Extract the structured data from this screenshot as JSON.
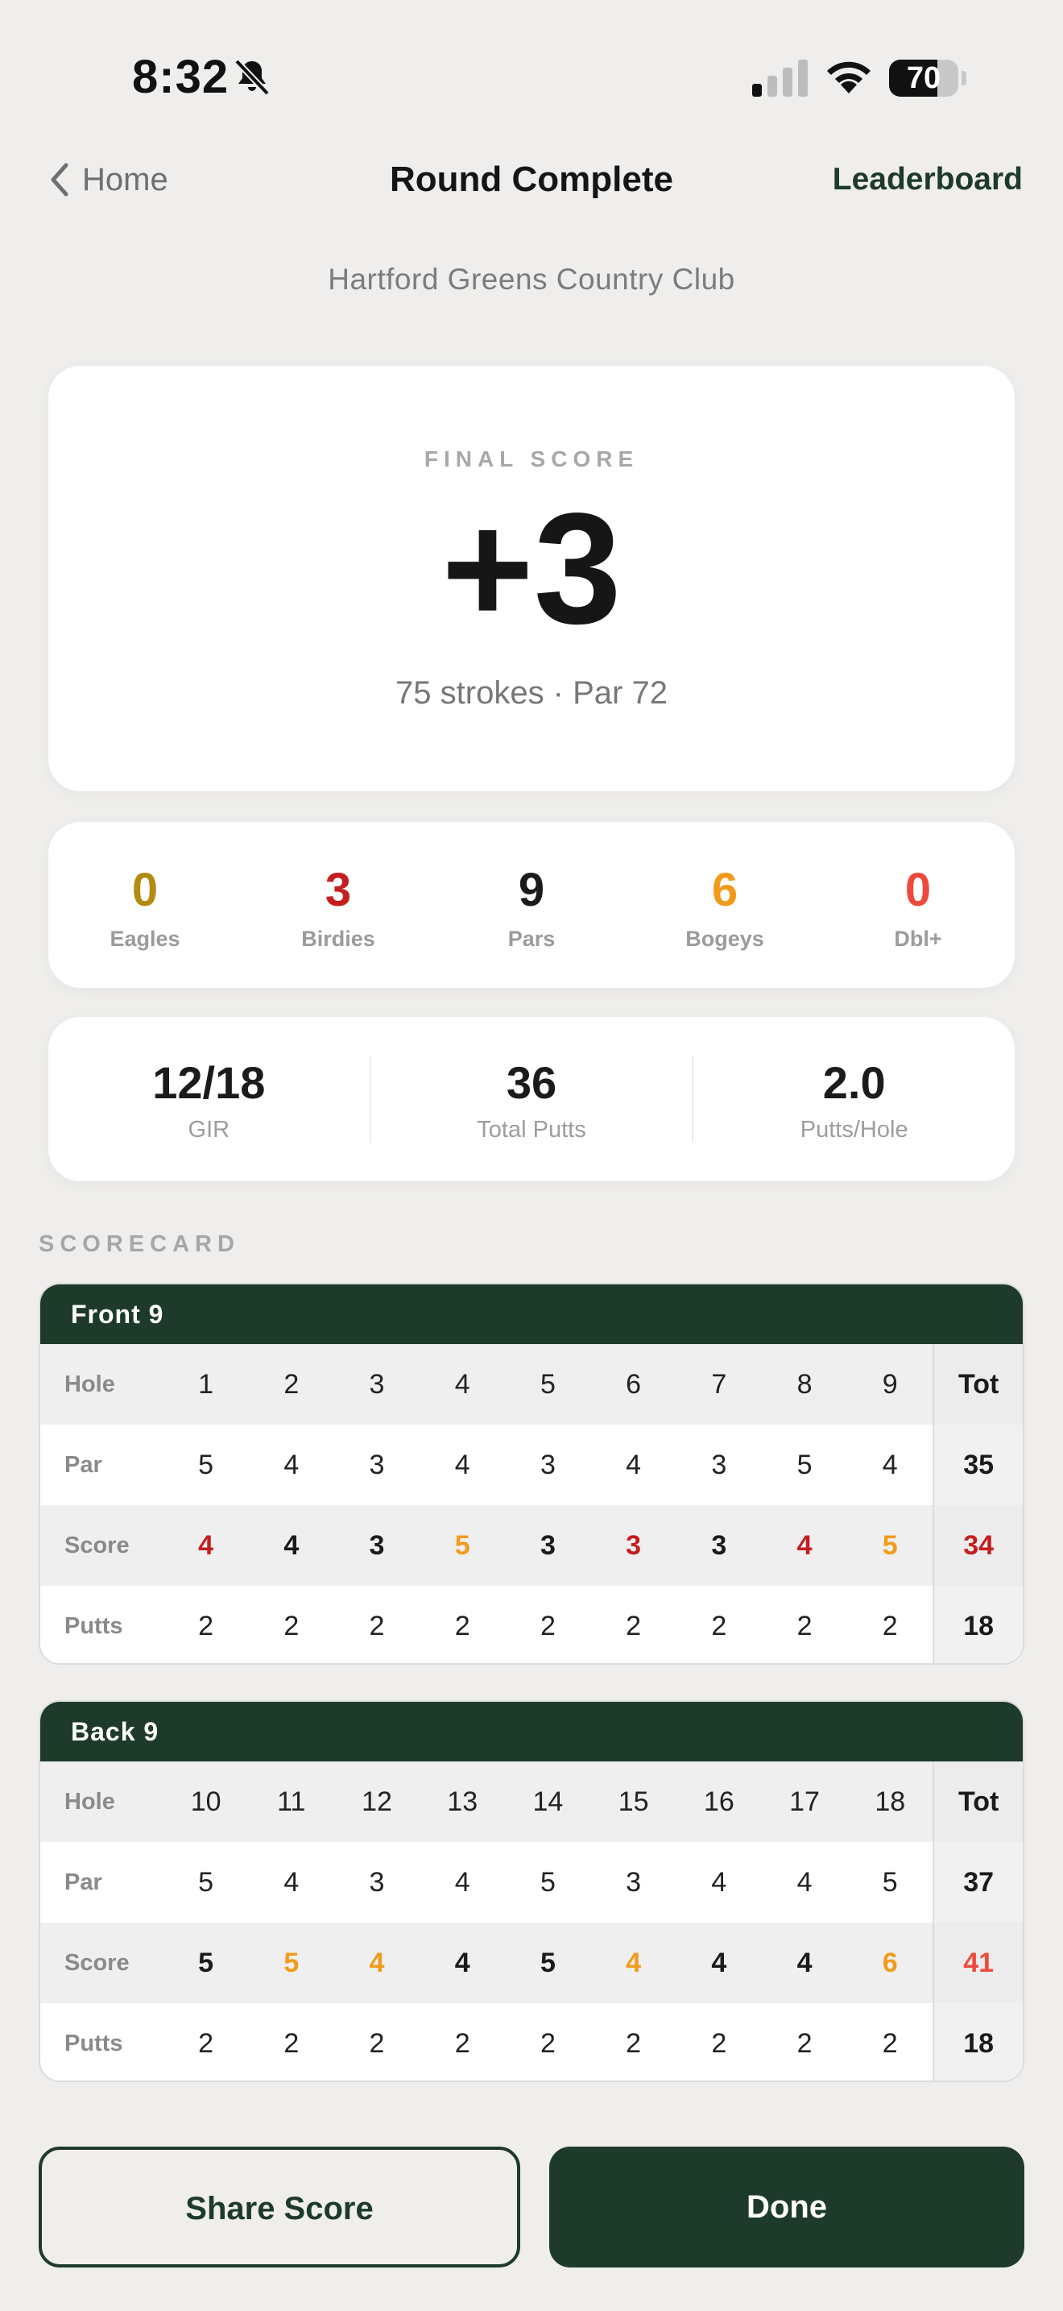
{
  "status_bar": {
    "time": "8:32",
    "battery": "70",
    "battery_fraction": 0.7
  },
  "nav": {
    "back_label": "Home",
    "title": "Round Complete",
    "right_label": "Leaderboard"
  },
  "course": {
    "name": "Hartford Greens Country Club"
  },
  "final_score": {
    "label": "FINAL SCORE",
    "value": "+3",
    "subtitle": "75 strokes · Par 72"
  },
  "summary": [
    {
      "value": "0",
      "label": "Eagles",
      "color": "#b48a10"
    },
    {
      "value": "3",
      "label": "Birdies",
      "color": "#c41e1e"
    },
    {
      "value": "9",
      "label": "Pars",
      "color": "#1b1b1b"
    },
    {
      "value": "6",
      "label": "Bogeys",
      "color": "#f29a1b"
    },
    {
      "value": "0",
      "label": "Dbl+",
      "color": "#ef4a3c"
    }
  ],
  "stats": [
    {
      "value": "12/18",
      "label": "GIR"
    },
    {
      "value": "36",
      "label": "Total Putts"
    },
    {
      "value": "2.0",
      "label": "Putts/Hole"
    }
  ],
  "scorecard_label": "SCORECARD",
  "row_labels": {
    "hole": "Hole",
    "par": "Par",
    "score": "Score",
    "putts": "Putts",
    "tot": "Tot"
  },
  "front": {
    "title": "Front 9",
    "holes": [
      "1",
      "2",
      "3",
      "4",
      "5",
      "6",
      "7",
      "8",
      "9"
    ],
    "par": [
      "5",
      "4",
      "3",
      "4",
      "3",
      "4",
      "3",
      "5",
      "4"
    ],
    "score": [
      "4",
      "4",
      "3",
      "5",
      "3",
      "3",
      "3",
      "4",
      "5"
    ],
    "putts": [
      "2",
      "2",
      "2",
      "2",
      "2",
      "2",
      "2",
      "2",
      "2"
    ],
    "par_total": "35",
    "score_total": "34",
    "putts_total": "18"
  },
  "back": {
    "title": "Back 9",
    "holes": [
      "10",
      "11",
      "12",
      "13",
      "14",
      "15",
      "16",
      "17",
      "18"
    ],
    "par": [
      "5",
      "4",
      "3",
      "4",
      "5",
      "3",
      "4",
      "4",
      "5"
    ],
    "score": [
      "5",
      "5",
      "4",
      "4",
      "5",
      "4",
      "4",
      "4",
      "6"
    ],
    "putts": [
      "2",
      "2",
      "2",
      "2",
      "2",
      "2",
      "2",
      "2",
      "2"
    ],
    "par_total": "37",
    "score_total": "41",
    "putts_total": "18"
  },
  "buttons": {
    "share": "Share Score",
    "done": "Done"
  },
  "colors": {
    "brand_green": "#1d3a2b",
    "birdie": "#c41e1e",
    "bogey": "#f29a1b",
    "over_total": "#ef4a3c"
  }
}
